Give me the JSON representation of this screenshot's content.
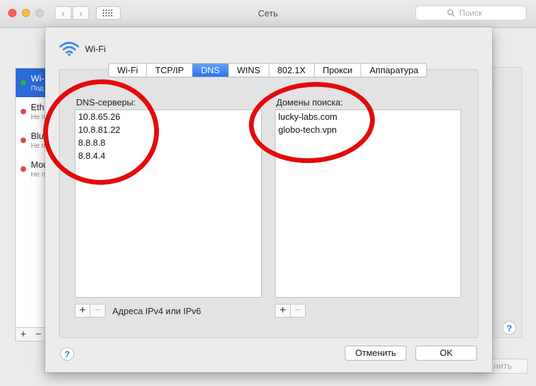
{
  "window": {
    "title": "Сеть",
    "search_placeholder": "Поиск",
    "back_icon": "‹",
    "forward_icon": "›",
    "apply_label": "нить"
  },
  "sidebar": {
    "items": [
      {
        "name": "Wi-",
        "status": "Под",
        "dot_color": "#2bb34a",
        "selected": true
      },
      {
        "name": "Eth",
        "status": "Не п",
        "dot_color": "#e8434a",
        "selected": false
      },
      {
        "name": "Blu",
        "status": "Не п",
        "dot_color": "#e8434a",
        "selected": false
      },
      {
        "name": "Mod",
        "status": "Не п",
        "dot_color": "#e8434a",
        "selected": false
      }
    ],
    "add_label": "+",
    "remove_label": "−"
  },
  "sheet": {
    "title": "Wi-Fi",
    "tabs": [
      {
        "label": "Wi-Fi",
        "active": false
      },
      {
        "label": "TCP/IP",
        "active": false
      },
      {
        "label": "DNS",
        "active": true
      },
      {
        "label": "WINS",
        "active": false
      },
      {
        "label": "802.1X",
        "active": false
      },
      {
        "label": "Прокси",
        "active": false
      },
      {
        "label": "Аппаратура",
        "active": false
      }
    ],
    "dns": {
      "label": "DNS-серверы:",
      "servers": [
        "10.8.65.26",
        "10.8.81.22",
        "8.8.8.8",
        "8.8.4.4"
      ],
      "hint": "Адреса IPv4 или IPv6"
    },
    "search_domains": {
      "label": "Домены поиска:",
      "domains": [
        "lucky-labs.com",
        "globo-tech.vpn"
      ]
    },
    "plus_label": "+",
    "minus_label": "−",
    "help_label": "?",
    "cancel_label": "Отменить",
    "ok_label": "OK"
  },
  "colors": {
    "accent": "#2a72ea",
    "annotation": "#e30b0b"
  }
}
